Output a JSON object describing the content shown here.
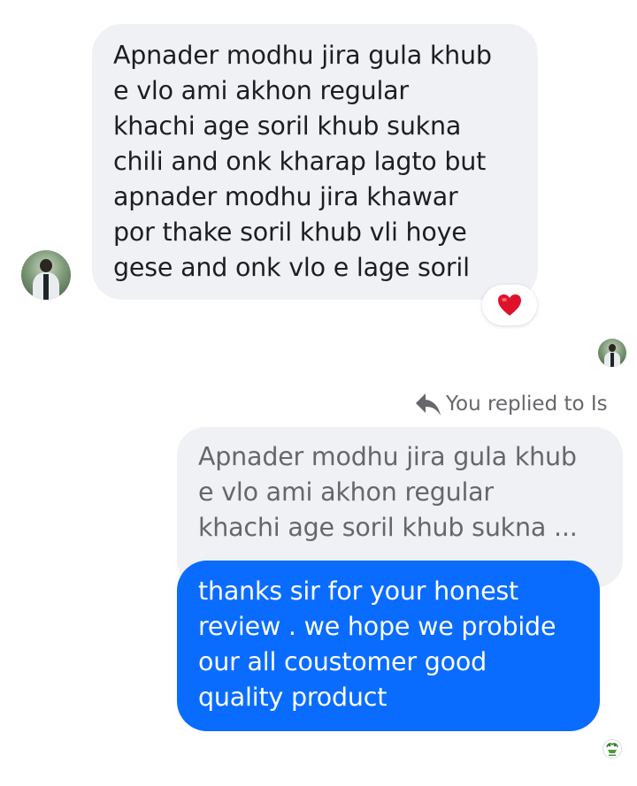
{
  "incoming_message": {
    "lines": [
      "Apnader modhu jira gula khub",
      "e vlo ami akhon regular",
      "khachi age soril khub sukna",
      "chili and onk kharap lagto but",
      "apnader modhu jira khawar",
      "por thake soril khub vli hoye",
      "gese and onk vlo e lage soril"
    ],
    "reaction": "❤️"
  },
  "reply_header": {
    "label": "You replied to Is"
  },
  "quoted_message": {
    "lines": [
      "Apnader modhu jira gula khub",
      "e vlo ami akhon regular",
      "khachi age soril khub sukna ..."
    ]
  },
  "outgoing_message": {
    "lines": [
      "thanks sir for your honest",
      "review .  we hope we probide",
      "our all coustomer good",
      "quality product"
    ]
  },
  "colors": {
    "incoming_bubble": "#f0f1f4",
    "outgoing_bubble": "#0a6cff",
    "secondary_text": "#65676b",
    "reaction_heart": "#e0112b"
  }
}
